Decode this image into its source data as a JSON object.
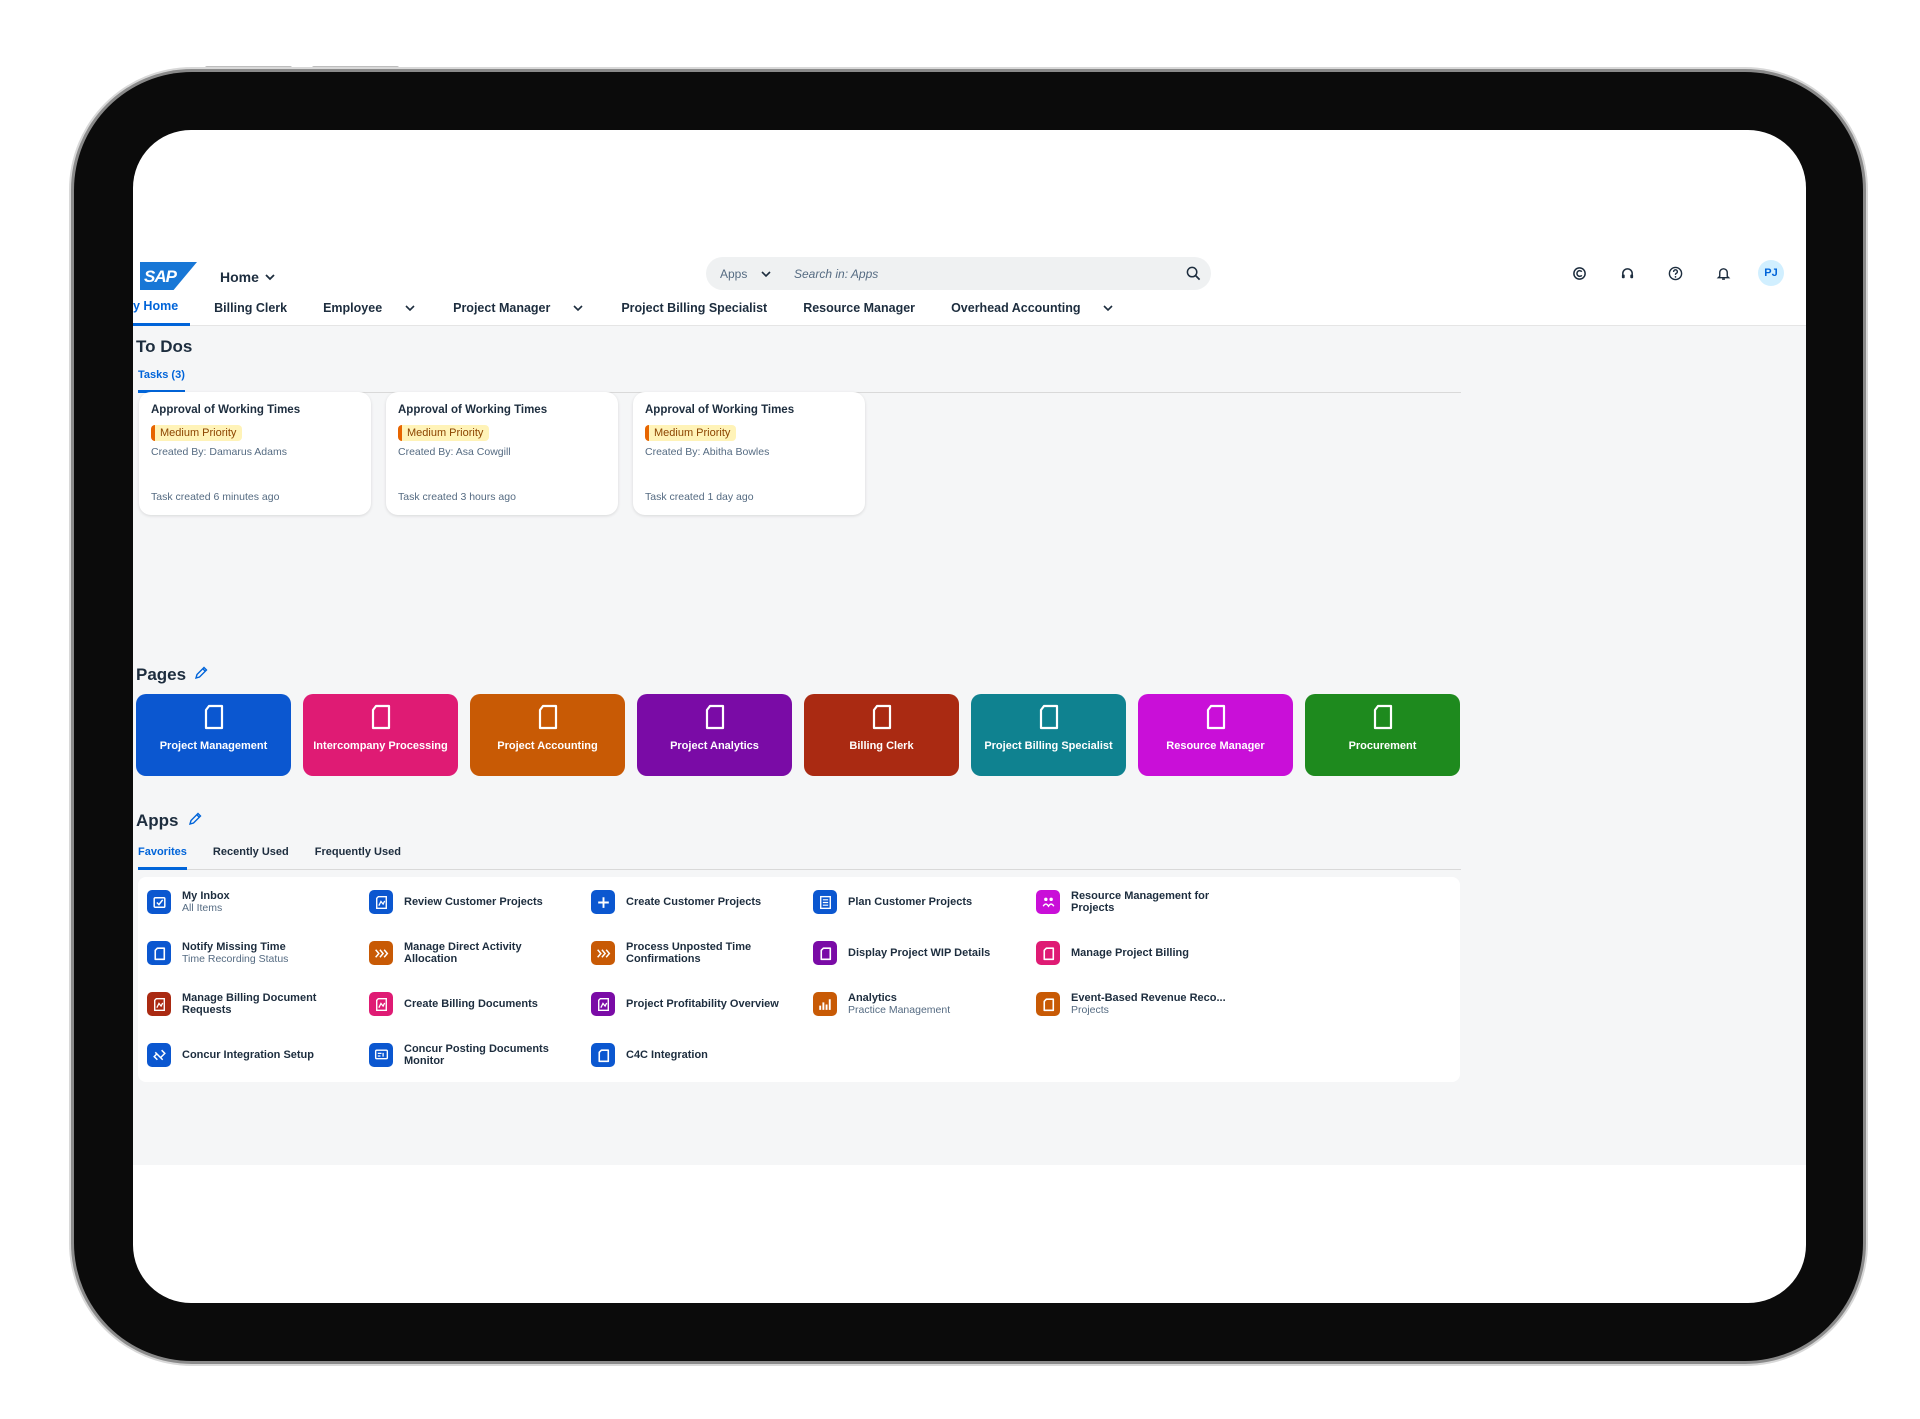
{
  "shell": {
    "logo_text": "SAP",
    "home_label": "Home",
    "search_scope": "Apps",
    "search_placeholder": "Search in: Apps",
    "avatar_initials": "PJ"
  },
  "nav": {
    "items": [
      {
        "label": "y Home",
        "dropdown": false,
        "active": true
      },
      {
        "label": "Billing Clerk",
        "dropdown": false
      },
      {
        "label": "Employee",
        "dropdown": true
      },
      {
        "label": "Project Manager",
        "dropdown": true
      },
      {
        "label": "Project Billing Specialist",
        "dropdown": false
      },
      {
        "label": "Resource Manager",
        "dropdown": false
      },
      {
        "label": "Overhead Accounting",
        "dropdown": true
      }
    ]
  },
  "todos": {
    "title": "To Dos",
    "tab": "Tasks (3)",
    "tasks": [
      {
        "title": "Approval of Working Times",
        "priority": "Medium Priority",
        "created_by": "Created By: Damarus Adams",
        "time": "Task created 6 minutes ago"
      },
      {
        "title": "Approval of Working Times",
        "priority": "Medium Priority",
        "created_by": "Created By: Asa Cowgill",
        "time": "Task created 3 hours ago"
      },
      {
        "title": "Approval of Working Times",
        "priority": "Medium Priority",
        "created_by": "Created By: Abitha Bowles",
        "time": "Task created 1 day ago"
      }
    ]
  },
  "pages": {
    "title": "Pages",
    "tiles": [
      {
        "label": "Project Management",
        "color": "#0b57d0"
      },
      {
        "label": "Intercompany Processing",
        "color": "#df1b74"
      },
      {
        "label": "Project Accounting",
        "color": "#c85a05"
      },
      {
        "label": "Project Analytics",
        "color": "#7a0ba6"
      },
      {
        "label": "Billing Clerk",
        "color": "#aa2a12"
      },
      {
        "label": "Project Billing Specialist",
        "color": "#0f8290"
      },
      {
        "label": "Resource Manager",
        "color": "#c90fd8"
      },
      {
        "label": "Procurement",
        "color": "#1e8a1e"
      }
    ]
  },
  "apps": {
    "title": "Apps",
    "tabs": [
      "Favorites",
      "Recently Used",
      "Frequently Used"
    ],
    "items": [
      {
        "title": "My Inbox",
        "sub": "All Items",
        "color": "#0b57d0",
        "icon": "inbox-icon"
      },
      {
        "title": "Review Customer Projects",
        "sub": "",
        "color": "#0b57d0",
        "icon": "review-icon"
      },
      {
        "title": "Create Customer Projects",
        "sub": "",
        "color": "#0b57d0",
        "icon": "plus-icon"
      },
      {
        "title": "Plan Customer Projects",
        "sub": "",
        "color": "#0b57d0",
        "icon": "plan-icon"
      },
      {
        "title": "Resource Management for\nProjects",
        "sub": "",
        "color": "#c90fd8",
        "icon": "resource-icon"
      },
      {
        "title": "Notify Missing Time",
        "sub": "Time Recording Status",
        "color": "#0b57d0",
        "icon": "document-icon"
      },
      {
        "title": "Manage Direct Activity\nAllocation",
        "sub": "",
        "color": "#c85a05",
        "icon": "allocation-icon"
      },
      {
        "title": "Process Unposted Time\nConfirmations",
        "sub": "",
        "color": "#c85a05",
        "icon": "allocation-icon"
      },
      {
        "title": "Display Project WIP Details",
        "sub": "",
        "color": "#7a0ba6",
        "icon": "document-icon"
      },
      {
        "title": "Manage Project Billing",
        "sub": "",
        "color": "#df1b74",
        "icon": "document-icon"
      },
      {
        "title": "Manage Billing Document\nRequests",
        "sub": "",
        "color": "#aa2a12",
        "icon": "review-icon"
      },
      {
        "title": "Create Billing Documents",
        "sub": "",
        "color": "#df1b74",
        "icon": "review-icon"
      },
      {
        "title": "Project Profitability Overview",
        "sub": "",
        "color": "#7a0ba6",
        "icon": "review-icon"
      },
      {
        "title": "Analytics",
        "sub": "Practice Management",
        "color": "#c85a05",
        "icon": "bar-chart-icon"
      },
      {
        "title": "Event-Based Revenue Reco...",
        "sub": "Projects",
        "color": "#c85a05",
        "icon": "document-icon"
      },
      {
        "title": "Concur Integration Setup",
        "sub": "",
        "color": "#0b57d0",
        "icon": "link-icon"
      },
      {
        "title": "Concur Posting Documents\nMonitor",
        "sub": "",
        "color": "#0b57d0",
        "icon": "monitor-icon"
      },
      {
        "title": "C4C Integration",
        "sub": "",
        "color": "#0b57d0",
        "icon": "document-icon"
      }
    ]
  }
}
